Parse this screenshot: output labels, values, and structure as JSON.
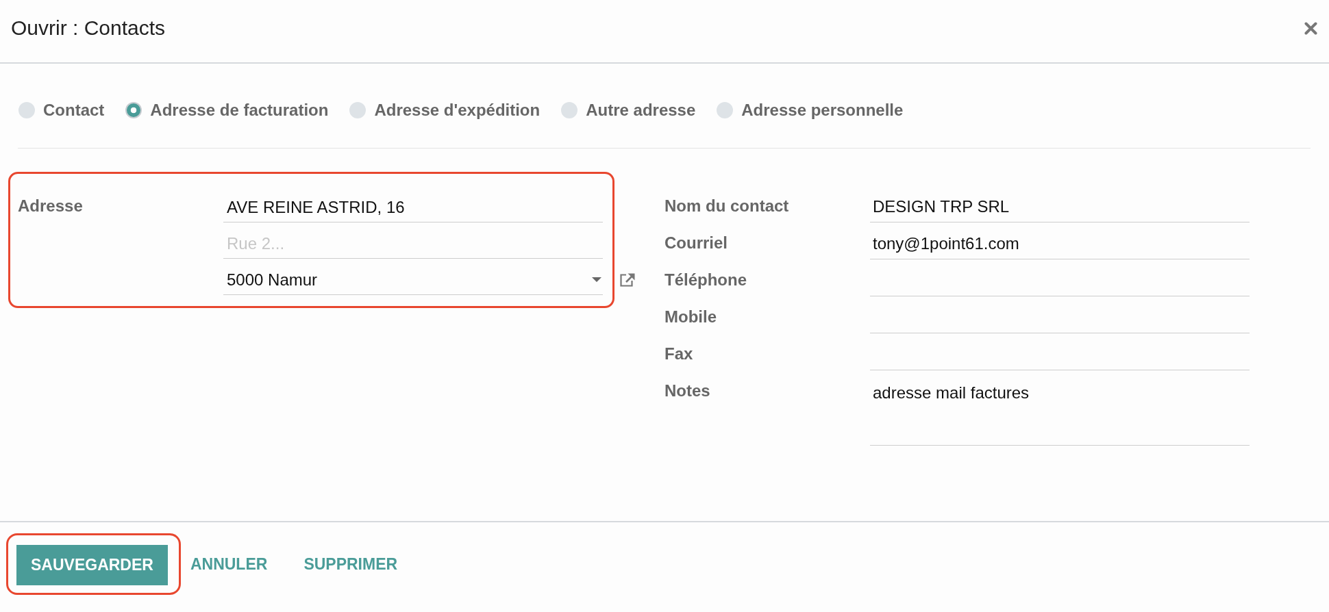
{
  "dialog": {
    "title": "Ouvrir : Contacts"
  },
  "address_types": [
    {
      "label": "Contact",
      "selected": false
    },
    {
      "label": "Adresse de facturation",
      "selected": true
    },
    {
      "label": "Adresse d'expédition",
      "selected": false
    },
    {
      "label": "Autre adresse",
      "selected": false
    },
    {
      "label": "Adresse personnelle",
      "selected": false
    }
  ],
  "address": {
    "label": "Adresse",
    "highlighted": true,
    "fields": [
      {
        "kind": "input",
        "value": "AVE REINE ASTRID, 16"
      },
      {
        "kind": "input",
        "placeholder": "Rue 2..."
      },
      {
        "kind": "dropdown",
        "value": "5000 Namur"
      }
    ]
  },
  "contact_fields": [
    {
      "kind": "input",
      "label": "Nom du contact",
      "value": "DESIGN TRP SRL"
    },
    {
      "kind": "input",
      "label": "Courriel",
      "value": "tony@1point61.com"
    },
    {
      "kind": "input",
      "label": "Téléphone"
    },
    {
      "kind": "input",
      "label": "Mobile"
    },
    {
      "kind": "input",
      "label": "Fax"
    },
    {
      "kind": "textarea",
      "label": "Notes",
      "value": "adresse mail factures"
    }
  ],
  "buttons": [
    {
      "kind": "primary",
      "label": "SAUVEGARDER",
      "highlighted": true
    },
    {
      "kind": "link",
      "label": "ANNULER",
      "highlighted": false
    },
    {
      "kind": "link",
      "label": "SUPPRIMER",
      "highlighted": false
    }
  ]
}
